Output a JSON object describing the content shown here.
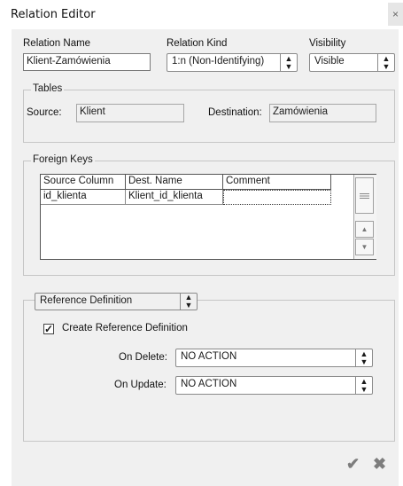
{
  "window": {
    "title": "Relation Editor",
    "close_glyph": "×"
  },
  "relation": {
    "name_label": "Relation Name",
    "name_value": "Klient-Zamówienia",
    "kind_label": "Relation Kind",
    "kind_value": "1:n (Non-Identifying)",
    "visibility_label": "Visibility",
    "visibility_value": "Visible"
  },
  "tables": {
    "legend": "Tables",
    "source_label": "Source:",
    "source_value": "Klient",
    "destination_label": "Destination:",
    "destination_value": "Zamówienia"
  },
  "foreign_keys": {
    "legend": "Foreign Keys",
    "columns": [
      "Source Column",
      "Dest. Name",
      "Comment"
    ],
    "rows": [
      {
        "source": "id_klienta",
        "dest": "Klient_id_klienta",
        "comment": ""
      }
    ]
  },
  "reference": {
    "section_value": "Reference Definition",
    "create_label": "Create Reference Definition",
    "create_checked": true,
    "on_delete_label": "On Delete:",
    "on_delete_value": "NO ACTION",
    "on_update_label": "On Update:",
    "on_update_value": "NO ACTION"
  },
  "icons": {
    "select_arrow": "select-updown-icon",
    "ok": "checkmark-icon",
    "cancel": "cross-icon"
  },
  "colors": {
    "dialog_bg": "#f0f0f0",
    "icon_gray": "#7d7d7d"
  }
}
